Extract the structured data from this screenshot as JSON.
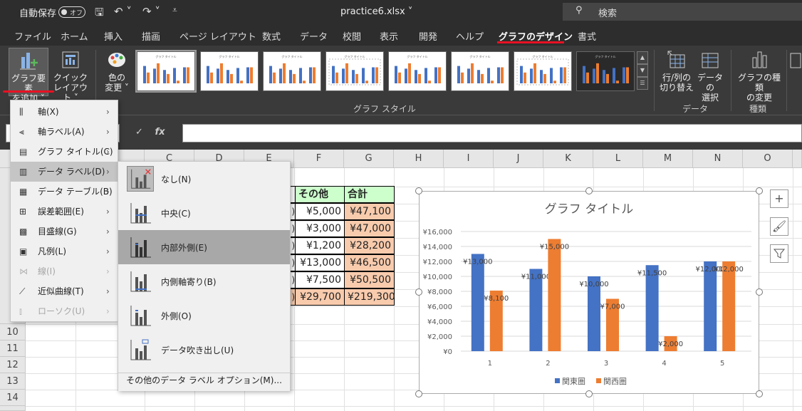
{
  "titlebar": {
    "autosave": "自動保存",
    "toggle": "オフ",
    "filename": "practice6.xlsx",
    "search": "検索"
  },
  "tabs": [
    "ファイル",
    "ホーム",
    "挿入",
    "描画",
    "ページ レイアウト",
    "数式",
    "データ",
    "校閲",
    "表示",
    "開発",
    "ヘルプ",
    "グラフのデザイン",
    "書式"
  ],
  "ribbon": {
    "add_element": [
      "グラフ要素",
      "を追加"
    ],
    "quick_layout": [
      "クイック",
      "レイアウト"
    ],
    "change_color": [
      "色の",
      "変更"
    ],
    "switch_rowcol": [
      "行/列の",
      "切り替え"
    ],
    "select_data": [
      "データの",
      "選択"
    ],
    "change_type": [
      "グラフの種類",
      "の変更"
    ],
    "group_style": "グラフ スタイル",
    "group_data": "データ",
    "group_type": "種類"
  },
  "columns": [
    "C",
    "D",
    "E",
    "F",
    "G",
    "H",
    "I",
    "J",
    "K",
    "L",
    "M",
    "N",
    "O"
  ],
  "rows": [
    "10",
    "11",
    "12",
    "13",
    "14"
  ],
  "table": {
    "headers": [
      "その他",
      "合計"
    ],
    "rows": [
      [
        "¥5,000",
        "¥47,100"
      ],
      [
        "¥3,000",
        "¥47,000"
      ],
      [
        "¥1,200",
        "¥28,200"
      ],
      [
        "¥13,000",
        "¥46,500"
      ],
      [
        "¥7,500",
        "¥50,500"
      ],
      [
        "¥29,700",
        "¥219,300"
      ]
    ]
  },
  "menu": [
    {
      "label": "軸(X)",
      "icon": "axis-icon",
      "arrow": true,
      "disabled": false
    },
    {
      "label": "軸ラベル(A)",
      "icon": "axis-label-icon",
      "arrow": true,
      "disabled": false
    },
    {
      "label": "グラフ タイトル(C)",
      "icon": "chart-title-icon",
      "arrow": true,
      "disabled": false
    },
    {
      "label": "データ ラベル(D)",
      "icon": "data-label-icon",
      "arrow": true,
      "disabled": false
    },
    {
      "label": "データ テーブル(B)",
      "icon": "data-table-icon",
      "arrow": true,
      "disabled": false
    },
    {
      "label": "誤差範囲(E)",
      "icon": "error-bar-icon",
      "arrow": true,
      "disabled": false
    },
    {
      "label": "目盛線(G)",
      "icon": "gridline-icon",
      "arrow": true,
      "disabled": false
    },
    {
      "label": "凡例(L)",
      "icon": "legend-icon",
      "arrow": true,
      "disabled": false
    },
    {
      "label": "線(I)",
      "icon": "line-icon",
      "arrow": true,
      "disabled": true
    },
    {
      "label": "近似曲線(T)",
      "icon": "trendline-icon",
      "arrow": true,
      "disabled": false
    },
    {
      "label": "ローソク(U)",
      "icon": "candle-icon",
      "arrow": true,
      "disabled": true
    }
  ],
  "submenu": {
    "items": [
      "なし(N)",
      "中央(C)",
      "内部外側(E)",
      "内側軸寄り(B)",
      "外側(O)",
      "データ吹き出し(U)"
    ],
    "more": "その他のデータ ラベル オプション(M)..."
  },
  "chart_data": {
    "type": "bar",
    "title": "グラフ タイトル",
    "categories": [
      "1",
      "2",
      "3",
      "4",
      "5"
    ],
    "series": [
      {
        "name": "関東圏",
        "values": [
          13000,
          11000,
          10000,
          11500,
          12000
        ],
        "labels": [
          "¥13,000",
          "¥11,000",
          "¥10,000",
          "¥11,500",
          "¥12,000"
        ],
        "color": "#4472c4"
      },
      {
        "name": "関西圏",
        "values": [
          8100,
          15000,
          7000,
          2000,
          12000
        ],
        "labels": [
          "¥8,100",
          "¥15,000",
          "¥7,000",
          "¥2,000",
          "¥12,000"
        ],
        "color": "#ed7d31"
      }
    ],
    "ylim": [
      0,
      16000
    ],
    "yticks": [
      "¥0",
      "¥2,000",
      "¥4,000",
      "¥6,000",
      "¥8,000",
      "¥10,000",
      "¥12,000",
      "¥14,000",
      "¥16,000"
    ],
    "legend": "bottom",
    "grid": true
  }
}
